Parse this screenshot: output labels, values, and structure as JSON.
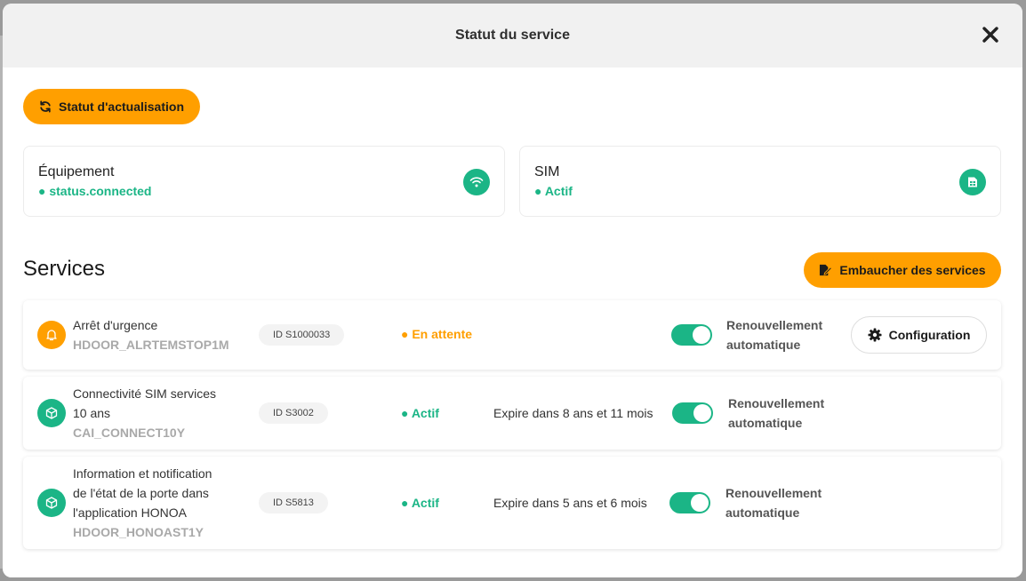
{
  "modal": {
    "title": "Statut du service",
    "close_icon": "close-icon"
  },
  "actions": {
    "refresh_label": "Statut d'actualisation",
    "hire_label": "Embaucher des services",
    "config_label": "Configuration"
  },
  "cards": {
    "equipment": {
      "title": "Équipement",
      "status": "● status.connected",
      "icon": "wifi-icon"
    },
    "sim": {
      "title": "SIM",
      "status": "● Actif",
      "icon": "sim-card-icon"
    }
  },
  "services": {
    "title": "Services",
    "rows": [
      {
        "icon": "bell-icon",
        "icon_color": "#ff9f00",
        "name_lines": [
          "Arrêt d'urgence"
        ],
        "code": "HDOOR_ALRTEMSTOP1M",
        "id": "ID S1000033",
        "status": "● En attente",
        "status_color": "#ff9f00",
        "expire": "",
        "renew_line1": "Renouvellement",
        "renew_line2": "automatique",
        "auto_renew": true
      },
      {
        "icon": "box-icon",
        "icon_color": "#1bb586",
        "name_lines": [
          "Connectivité SIM services",
          "10 ans"
        ],
        "code": "CAI_CONNECT10Y",
        "id": "ID S3002",
        "status": "● Actif",
        "status_color": "#1bb586",
        "expire": "Expire dans 8 ans et 11 mois",
        "renew_line1": "Renouvellement",
        "renew_line2": "automatique",
        "auto_renew": true
      },
      {
        "icon": "box-icon",
        "icon_color": "#1bb586",
        "name_lines": [
          "Information et notification",
          "de l'état de la porte dans",
          "l'application HONOA"
        ],
        "code": "HDOOR_HONOAST1Y",
        "id": "ID S5813",
        "status": "● Actif",
        "status_color": "#1bb586",
        "expire": "Expire dans 5 ans et 6 mois",
        "renew_line1": "Renouvellement",
        "renew_line2": "automatique",
        "auto_renew": true
      }
    ]
  },
  "colors": {
    "accent": "#ff9f00",
    "success": "#1bb586",
    "muted": "#a9a9a9"
  }
}
